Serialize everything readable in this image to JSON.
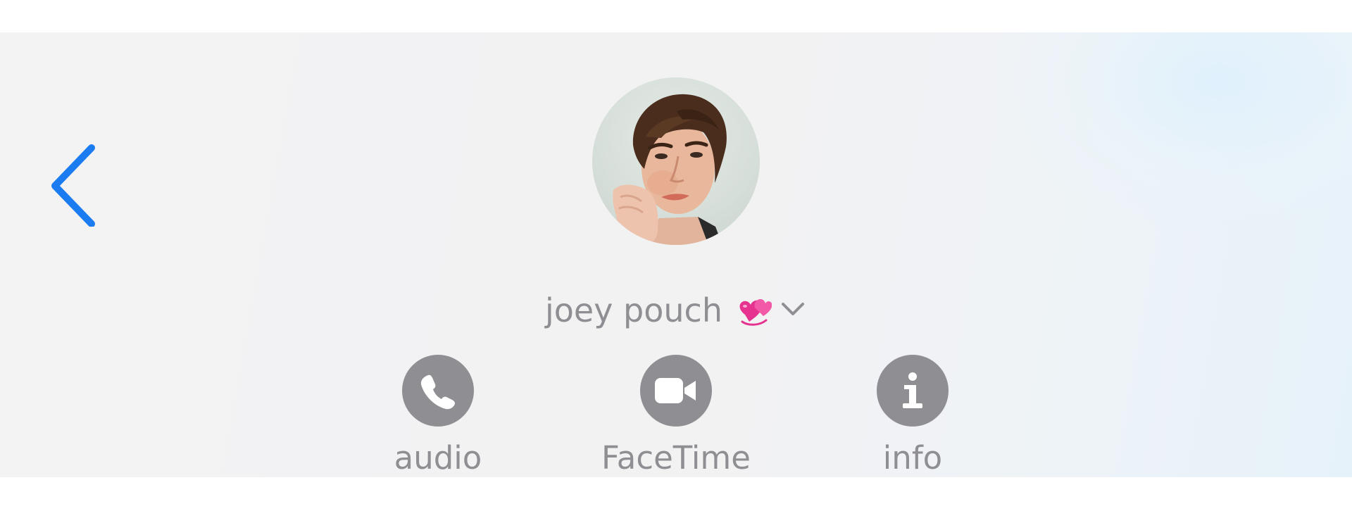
{
  "header": {
    "back_icon": "chevron-left-icon",
    "accent_color": "#1a7cf0"
  },
  "contact": {
    "name": "joey pouch",
    "name_emoji": "💞",
    "name_emoji_icon": "revolving-hearts-icon",
    "dropdown_icon": "chevron-down-icon",
    "avatar_icon": "contact-photo"
  },
  "actions": [
    {
      "label": "audio",
      "icon": "phone-icon"
    },
    {
      "label": "FaceTime",
      "icon": "video-camera-icon"
    },
    {
      "label": "info",
      "icon": "info-icon"
    }
  ],
  "colors": {
    "secondary_gray": "#8e8e93",
    "panel_background": "#f2f2f3"
  }
}
